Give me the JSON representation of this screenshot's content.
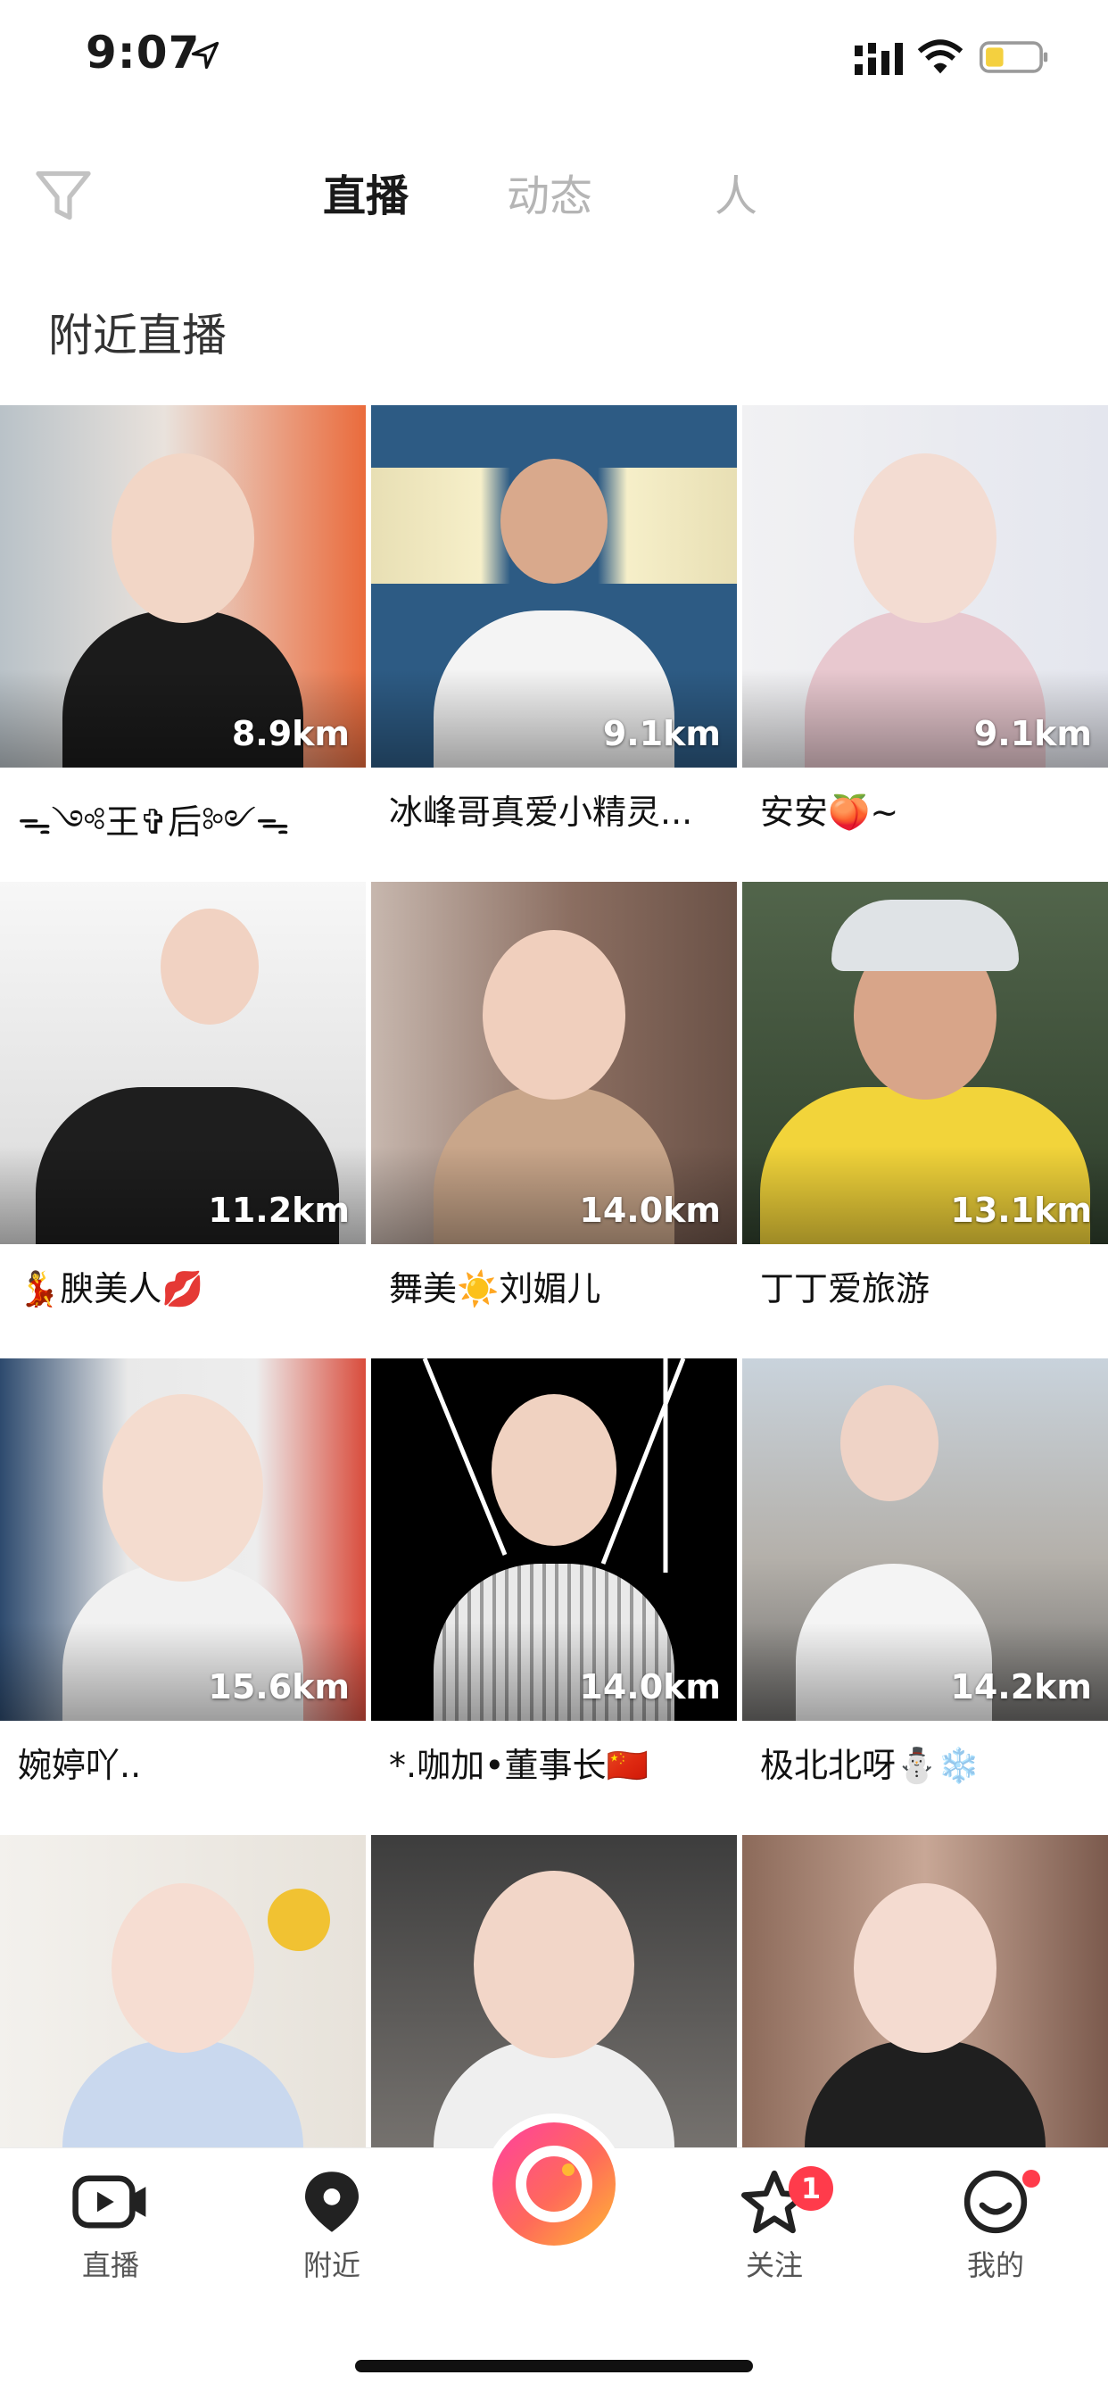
{
  "status_bar": {
    "time": "9:07"
  },
  "top_nav": {
    "tabs": [
      {
        "label": "直播",
        "active": true
      },
      {
        "label": "动态",
        "active": false
      },
      {
        "label": "人",
        "active": false
      }
    ]
  },
  "section_title": "附近直播",
  "streams": [
    {
      "distance": "8.9km",
      "name": "ᯓ༺王✞后༻ᯓ"
    },
    {
      "distance": "9.1km",
      "name": "冰峰哥真爱小精灵..."
    },
    {
      "distance": "9.1km",
      "name": "安安🍑~"
    },
    {
      "distance": "11.2km",
      "name": "💃腴美人💋"
    },
    {
      "distance": "14.0km",
      "name": "舞美☀️刘媚儿"
    },
    {
      "distance": "13.1km",
      "name": "丁丁爱旅游"
    },
    {
      "distance": "15.6km",
      "name": "婉婷吖.."
    },
    {
      "distance": "14.0km",
      "name": "*.咖加•董事长🇨🇳"
    },
    {
      "distance": "14.2km",
      "name": "极北北呀⛄❄️"
    },
    {
      "distance": "",
      "name": ""
    },
    {
      "distance": "",
      "name": ""
    },
    {
      "distance": "",
      "name": ""
    }
  ],
  "tab_bar": {
    "items": [
      {
        "label": "直播",
        "icon": "live-video-icon"
      },
      {
        "label": "附近",
        "icon": "location-pin-icon"
      },
      {
        "label": "关注",
        "icon": "star-icon",
        "badge": "1"
      },
      {
        "label": "我的",
        "icon": "smile-profile-icon"
      }
    ],
    "center_button_icon": "camera-lens-icon"
  },
  "colors": {
    "accent_pink": "#ff3fa0",
    "accent_orange": "#ffb833",
    "badge_red": "#ff3b4b"
  }
}
